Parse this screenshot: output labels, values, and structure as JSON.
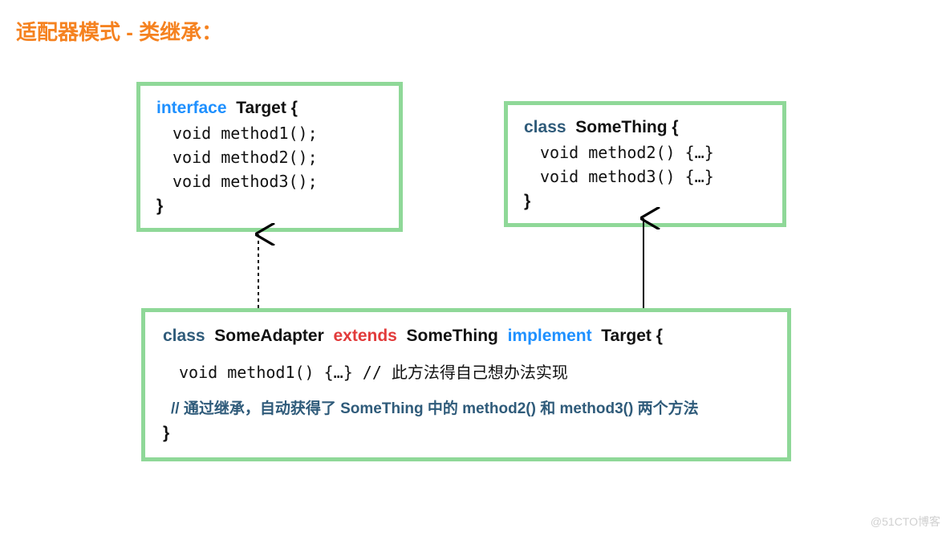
{
  "title": "适配器模式 - 类继承：",
  "target": {
    "keyword": "interface",
    "name": "Target",
    "openBrace": " {",
    "lines": [
      "void method1();",
      "void method2();",
      "void method3();"
    ],
    "closeBrace": "}"
  },
  "something": {
    "keyword": "class",
    "name": "SomeThing",
    "openBrace": " {",
    "lines": [
      "void method2() {…}",
      "void method3() {…}"
    ],
    "closeBrace": "}"
  },
  "adapter": {
    "kwClass": "class",
    "name1": "SomeAdapter",
    "kwExtends": "extends",
    "name2": "SomeThing",
    "kwImplement": "implement",
    "name3": "Target",
    "openBrace": " {",
    "line1_code": "void method1() {…}  // ",
    "line1_comment": " 此方法得自己想办法实现",
    "commentBlue": "// 通过继承，自动获得了 SomeThing 中的 method2() 和 method3() 两个方法",
    "closeBrace": "}"
  },
  "watermark": "@51CTO博客"
}
